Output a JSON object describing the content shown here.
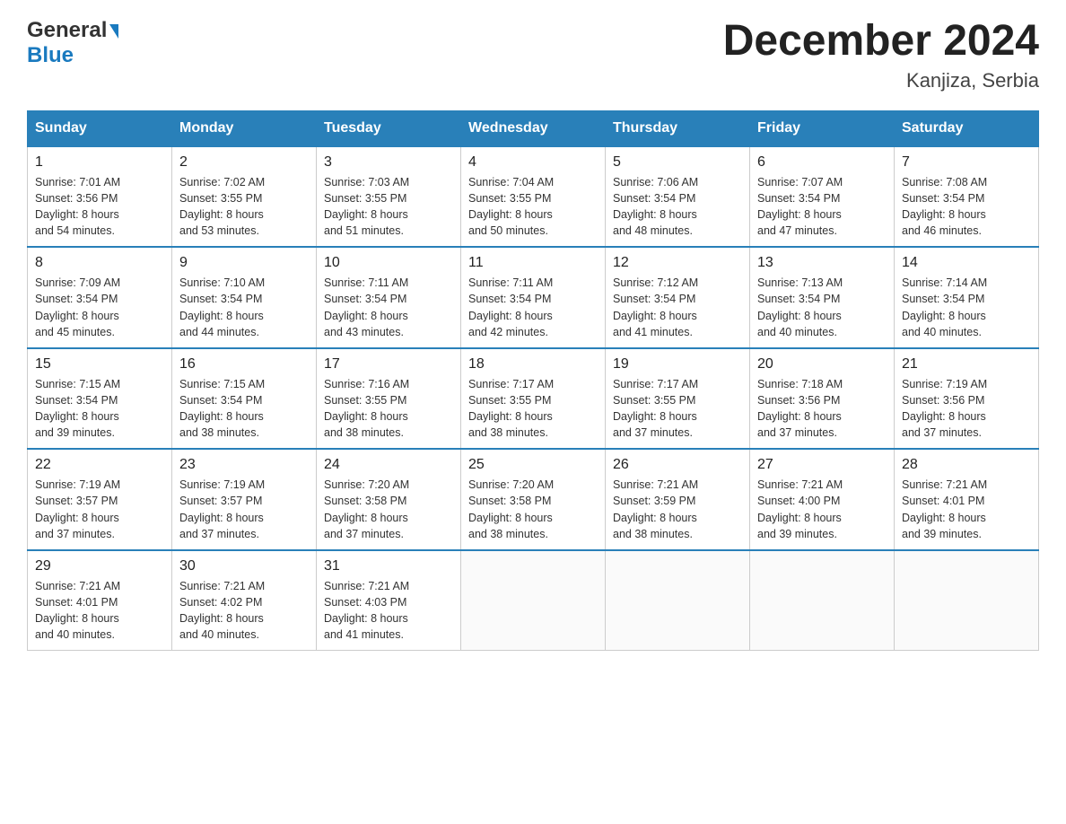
{
  "header": {
    "logo_general": "General",
    "logo_blue": "Blue",
    "month_title": "December 2024",
    "location": "Kanjiza, Serbia"
  },
  "days_of_week": [
    "Sunday",
    "Monday",
    "Tuesday",
    "Wednesday",
    "Thursday",
    "Friday",
    "Saturday"
  ],
  "weeks": [
    [
      {
        "day": "1",
        "sunrise": "7:01 AM",
        "sunset": "3:56 PM",
        "daylight": "8 hours and 54 minutes."
      },
      {
        "day": "2",
        "sunrise": "7:02 AM",
        "sunset": "3:55 PM",
        "daylight": "8 hours and 53 minutes."
      },
      {
        "day": "3",
        "sunrise": "7:03 AM",
        "sunset": "3:55 PM",
        "daylight": "8 hours and 51 minutes."
      },
      {
        "day": "4",
        "sunrise": "7:04 AM",
        "sunset": "3:55 PM",
        "daylight": "8 hours and 50 minutes."
      },
      {
        "day": "5",
        "sunrise": "7:06 AM",
        "sunset": "3:54 PM",
        "daylight": "8 hours and 48 minutes."
      },
      {
        "day": "6",
        "sunrise": "7:07 AM",
        "sunset": "3:54 PM",
        "daylight": "8 hours and 47 minutes."
      },
      {
        "day": "7",
        "sunrise": "7:08 AM",
        "sunset": "3:54 PM",
        "daylight": "8 hours and 46 minutes."
      }
    ],
    [
      {
        "day": "8",
        "sunrise": "7:09 AM",
        "sunset": "3:54 PM",
        "daylight": "8 hours and 45 minutes."
      },
      {
        "day": "9",
        "sunrise": "7:10 AM",
        "sunset": "3:54 PM",
        "daylight": "8 hours and 44 minutes."
      },
      {
        "day": "10",
        "sunrise": "7:11 AM",
        "sunset": "3:54 PM",
        "daylight": "8 hours and 43 minutes."
      },
      {
        "day": "11",
        "sunrise": "7:11 AM",
        "sunset": "3:54 PM",
        "daylight": "8 hours and 42 minutes."
      },
      {
        "day": "12",
        "sunrise": "7:12 AM",
        "sunset": "3:54 PM",
        "daylight": "8 hours and 41 minutes."
      },
      {
        "day": "13",
        "sunrise": "7:13 AM",
        "sunset": "3:54 PM",
        "daylight": "8 hours and 40 minutes."
      },
      {
        "day": "14",
        "sunrise": "7:14 AM",
        "sunset": "3:54 PM",
        "daylight": "8 hours and 40 minutes."
      }
    ],
    [
      {
        "day": "15",
        "sunrise": "7:15 AM",
        "sunset": "3:54 PM",
        "daylight": "8 hours and 39 minutes."
      },
      {
        "day": "16",
        "sunrise": "7:15 AM",
        "sunset": "3:54 PM",
        "daylight": "8 hours and 38 minutes."
      },
      {
        "day": "17",
        "sunrise": "7:16 AM",
        "sunset": "3:55 PM",
        "daylight": "8 hours and 38 minutes."
      },
      {
        "day": "18",
        "sunrise": "7:17 AM",
        "sunset": "3:55 PM",
        "daylight": "8 hours and 38 minutes."
      },
      {
        "day": "19",
        "sunrise": "7:17 AM",
        "sunset": "3:55 PM",
        "daylight": "8 hours and 37 minutes."
      },
      {
        "day": "20",
        "sunrise": "7:18 AM",
        "sunset": "3:56 PM",
        "daylight": "8 hours and 37 minutes."
      },
      {
        "day": "21",
        "sunrise": "7:19 AM",
        "sunset": "3:56 PM",
        "daylight": "8 hours and 37 minutes."
      }
    ],
    [
      {
        "day": "22",
        "sunrise": "7:19 AM",
        "sunset": "3:57 PM",
        "daylight": "8 hours and 37 minutes."
      },
      {
        "day": "23",
        "sunrise": "7:19 AM",
        "sunset": "3:57 PM",
        "daylight": "8 hours and 37 minutes."
      },
      {
        "day": "24",
        "sunrise": "7:20 AM",
        "sunset": "3:58 PM",
        "daylight": "8 hours and 37 minutes."
      },
      {
        "day": "25",
        "sunrise": "7:20 AM",
        "sunset": "3:58 PM",
        "daylight": "8 hours and 38 minutes."
      },
      {
        "day": "26",
        "sunrise": "7:21 AM",
        "sunset": "3:59 PM",
        "daylight": "8 hours and 38 minutes."
      },
      {
        "day": "27",
        "sunrise": "7:21 AM",
        "sunset": "4:00 PM",
        "daylight": "8 hours and 39 minutes."
      },
      {
        "day": "28",
        "sunrise": "7:21 AM",
        "sunset": "4:01 PM",
        "daylight": "8 hours and 39 minutes."
      }
    ],
    [
      {
        "day": "29",
        "sunrise": "7:21 AM",
        "sunset": "4:01 PM",
        "daylight": "8 hours and 40 minutes."
      },
      {
        "day": "30",
        "sunrise": "7:21 AM",
        "sunset": "4:02 PM",
        "daylight": "8 hours and 40 minutes."
      },
      {
        "day": "31",
        "sunrise": "7:21 AM",
        "sunset": "4:03 PM",
        "daylight": "8 hours and 41 minutes."
      },
      null,
      null,
      null,
      null
    ]
  ],
  "labels": {
    "sunrise": "Sunrise:",
    "sunset": "Sunset:",
    "daylight": "Daylight:"
  }
}
